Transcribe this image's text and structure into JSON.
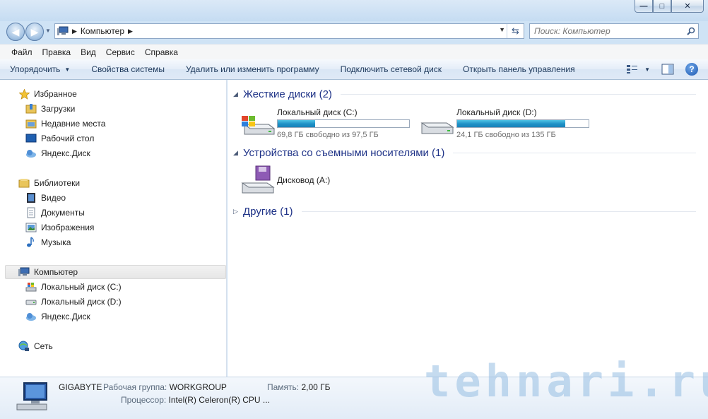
{
  "window": {
    "min_label": "—",
    "max_label": "□",
    "close_label": "✕"
  },
  "address": {
    "path": "Компьютер",
    "search_placeholder": "Поиск: Компьютер"
  },
  "menu": [
    "Файл",
    "Правка",
    "Вид",
    "Сервис",
    "Справка"
  ],
  "toolbar": {
    "organize": "Упорядочить",
    "system_properties": "Свойства системы",
    "uninstall": "Удалить или изменить программу",
    "map_drive": "Подключить сетевой диск",
    "control_panel": "Открыть панель управления",
    "help": "?"
  },
  "nav": {
    "favorites": "Избранное",
    "downloads": "Загрузки",
    "recent": "Недавние места",
    "desktop": "Рабочий стол",
    "yadisk1": "Яндекс.Диск",
    "libraries": "Библиотеки",
    "video": "Видео",
    "documents": "Документы",
    "pictures": "Изображения",
    "music": "Музыка",
    "computer": "Компьютер",
    "drive_c": "Локальный диск (C:)",
    "drive_d": "Локальный диск (D:)",
    "yadisk2": "Яндекс.Диск",
    "network": "Сеть"
  },
  "groups": {
    "hdd": "Жесткие диски (2)",
    "removable": "Устройства со съемными носителями (1)",
    "other": "Другие (1)"
  },
  "drives": [
    {
      "name": "Локальный диск (C:)",
      "free": "69,8 ГБ свободно из 97,5 ГБ",
      "used_fraction": 0.284
    },
    {
      "name": "Локальный диск (D:)",
      "free": "24,1 ГБ свободно из 135 ГБ",
      "used_fraction": 0.821
    }
  ],
  "floppy": {
    "name": "Дисковод (A:)"
  },
  "details": {
    "name": "GIGABYTE",
    "workgroup_label": "Рабочая группа:",
    "workgroup": "WORKGROUP",
    "memory_label": "Память:",
    "memory": "2,00 ГБ",
    "cpu_label": "Процессор:",
    "cpu": "Intel(R) Celeron(R) CPU ..."
  },
  "watermark": "tehnari.ru",
  "colors": {
    "accent": "#1e3287",
    "bar_fill": "#1e90c6"
  }
}
